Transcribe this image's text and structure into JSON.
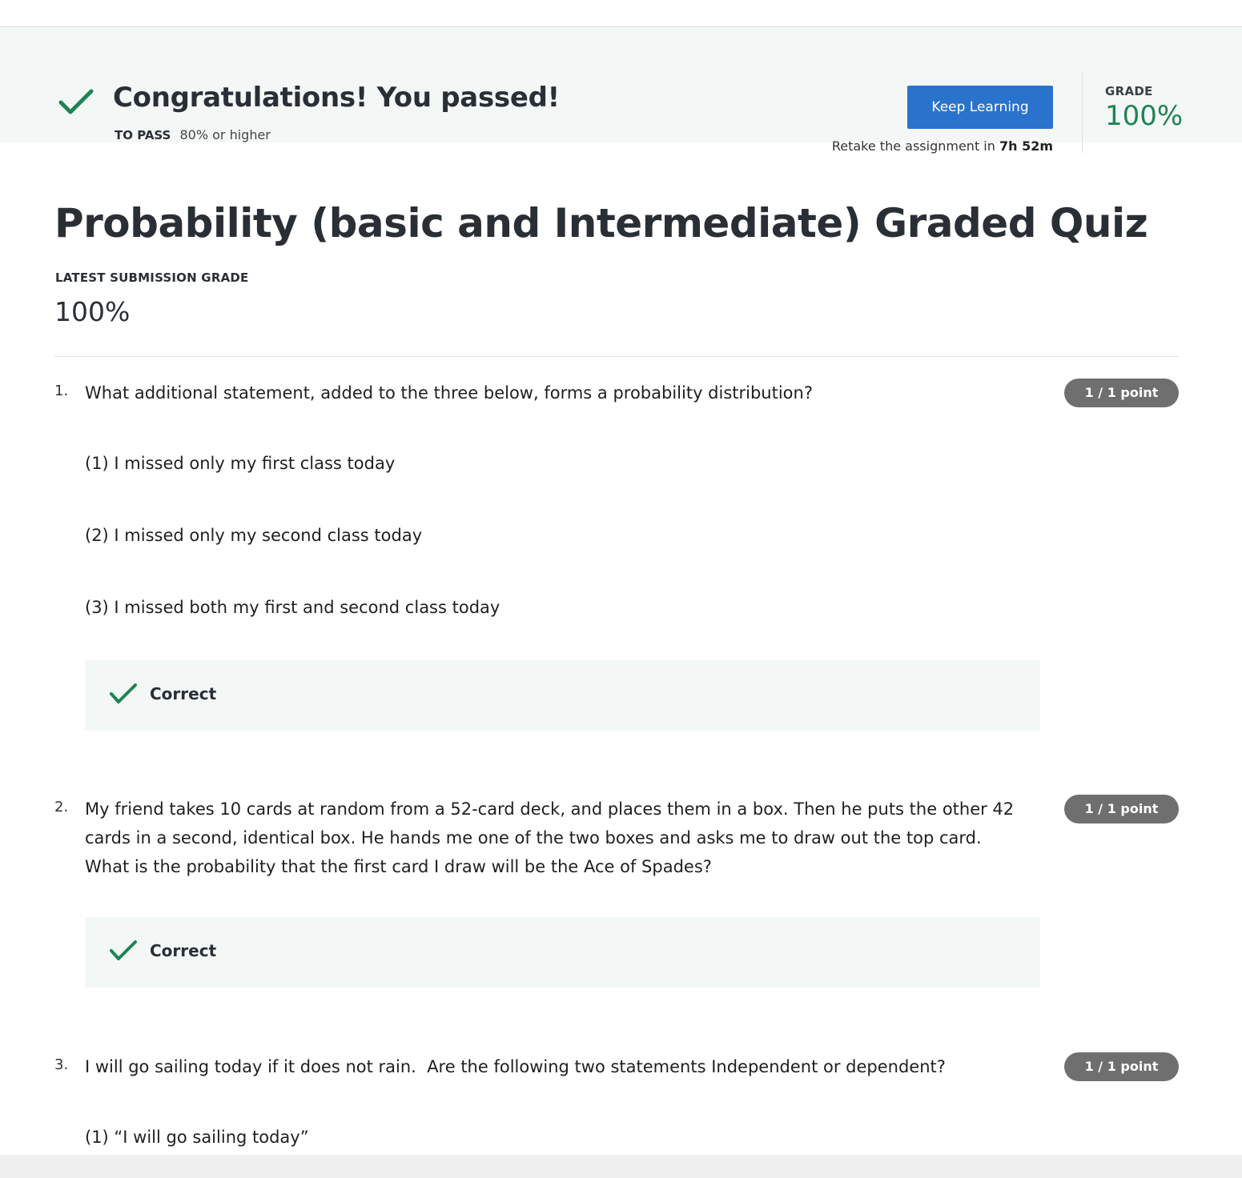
{
  "banner": {
    "title": "Congratulations! You passed!",
    "to_pass_label": "TO PASS",
    "to_pass_value": "80% or higher",
    "keep_learning_label": "Keep Learning",
    "retake_prefix": "Retake the assignment in ",
    "retake_time": "7h 52m",
    "grade_label": "GRADE",
    "grade_value": "100%"
  },
  "quiz": {
    "title": "Probability (basic and Intermediate) Graded Quiz",
    "latest_label": "LATEST SUBMISSION GRADE",
    "latest_value": "100%"
  },
  "questions": [
    {
      "number": "1.",
      "text": "What additional statement, added to the three below, forms a probability distribution?",
      "points": "1 / 1 point",
      "options": [
        "(1) I missed only my first class today",
        "(2) I missed only my second class today",
        "(3) I missed both my first and second class today"
      ],
      "feedback": "Correct"
    },
    {
      "number": "2.",
      "text": "My friend takes 10 cards at random from a 52-card deck, and places them in a box. Then he puts the other 42 cards in a second, identical box. He hands me one of the two boxes and asks me to draw out the top card. What is the probability that the first card I draw will be the Ace of Spades?",
      "points": "1 / 1 point",
      "feedback": "Correct"
    },
    {
      "number": "3.",
      "text": "I will go sailing today if it does not rain.  Are the following two statements Independent or dependent?",
      "points": "1 / 1 point",
      "options": [
        "(1) “I will go sailing today”"
      ]
    }
  ],
  "colors": {
    "accent_green": "#1f8354",
    "button_blue": "#2a73cc",
    "banner_bg": "#f3f8f6",
    "pill_gray": "#6f6f6f"
  },
  "icons": {
    "banner_check": "check-icon",
    "feedback_check": "check-icon"
  }
}
